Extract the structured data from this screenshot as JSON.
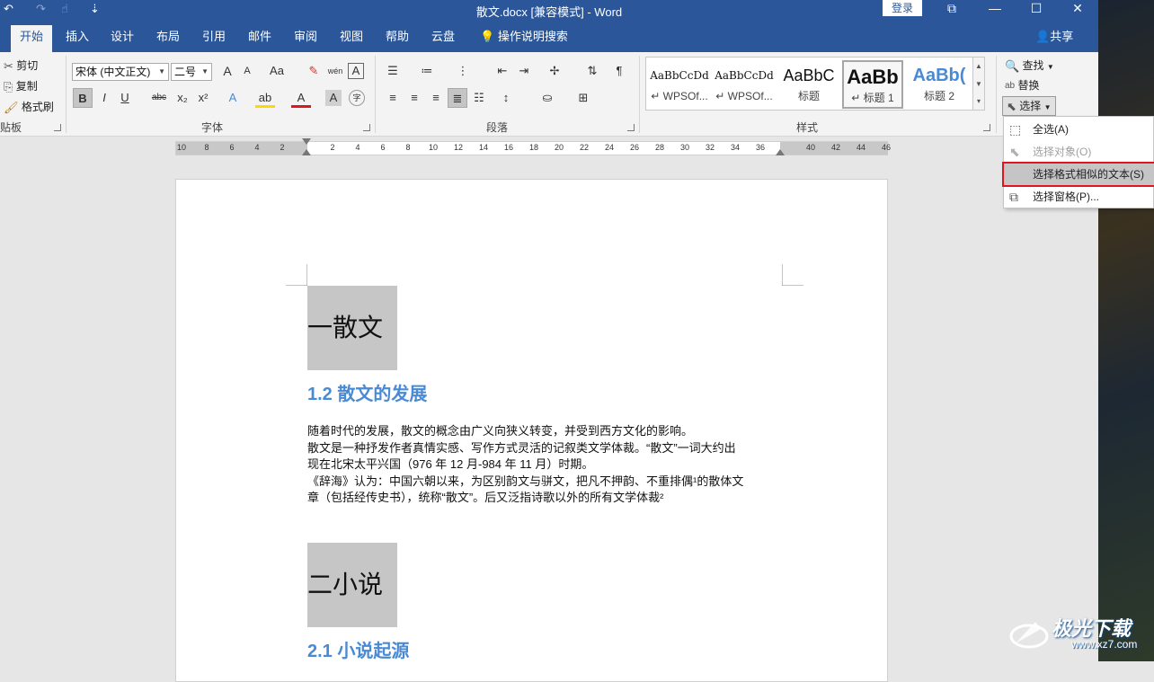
{
  "window": {
    "title": "散文.docx [兼容模式] - Word",
    "login": "登录",
    "qa_undo": "↶",
    "qa_redo": "↷",
    "qa_touch": "☝",
    "qa_customize": "⇣",
    "btn_ribbon_display": "⧉",
    "btn_minimize": "—",
    "btn_maximize": "☐",
    "btn_close": "✕"
  },
  "tabs": [
    {
      "label": "开始",
      "active": true
    },
    {
      "label": "插入"
    },
    {
      "label": "设计"
    },
    {
      "label": "布局"
    },
    {
      "label": "引用"
    },
    {
      "label": "邮件"
    },
    {
      "label": "审阅"
    },
    {
      "label": "视图"
    },
    {
      "label": "帮助"
    },
    {
      "label": "云盘"
    }
  ],
  "tell_me": "说明搜索",
  "tell_me_full": "操作说明搜索",
  "share": "共享",
  "clipboard": {
    "cut": "剪切",
    "copy": "复制",
    "format_painter": "格式刷",
    "label": "贴板"
  },
  "font": {
    "name": "宋体 (中文正文)",
    "size": "二号",
    "label": "字体",
    "bold": "B",
    "italic": "I",
    "underline": "U",
    "strike": "abc",
    "sub": "x₂",
    "sup": "x²",
    "grow": "A",
    "shrink": "A",
    "case": "Aa",
    "clear": "✎",
    "phonetic": "wén",
    "border": "A",
    "effect": "A",
    "highlight": "ab",
    "color": "A",
    "shade": "A",
    "enclose": "字"
  },
  "paragraph": {
    "label": "段落"
  },
  "styles": {
    "label": "样式",
    "items": [
      {
        "sample": "AaBbCcDd",
        "name": "↵ WPSOf..."
      },
      {
        "sample": "AaBbCcDd",
        "name": "↵ WPSOf..."
      },
      {
        "sample": "AaBbC",
        "name": "标题"
      },
      {
        "sample": "AaBb",
        "name": "↵ 标题 1",
        "selected": true
      },
      {
        "sample": "AaBb(",
        "name": "标题 2"
      }
    ]
  },
  "editing": {
    "find": "查找",
    "replace": "替换",
    "select": "选择"
  },
  "select_menu": [
    {
      "label": "全选(A)",
      "icon": "select-all-icon",
      "state": "normal"
    },
    {
      "label": "选择对象(O)",
      "icon": "select-objects-icon",
      "state": "disabled"
    },
    {
      "label": "选择格式相似的文本(S)",
      "icon": "",
      "state": "highlighted"
    },
    {
      "label": "选择窗格(P)...",
      "icon": "selection-pane-icon",
      "state": "normal"
    }
  ],
  "ruler_ticks": [
    "10",
    "8",
    "6",
    "4",
    "2",
    "",
    "2",
    "4",
    "6",
    "8",
    "10",
    "12",
    "14",
    "16",
    "18",
    "20",
    "22",
    "24",
    "26",
    "28",
    "30",
    "32",
    "34",
    "36",
    "",
    "40",
    "42",
    "44",
    "46"
  ],
  "document": {
    "h1_a": "一散文",
    "h2_a": "1.2 散文的发展",
    "para_lines": [
      "随着时代的发展，散文的概念由广义向狭义转变，并受到西方文化的影响。",
      "散文是一种抒发作者真情实感、写作方式灵活的记叙类文学体裁。“散文”一词大约出",
      "现在北宋太平兴国（976 年 12 月-984 年 11 月）时期。",
      "《辞海》认为：中国六朝以来，为区别韵文与骈文，把凡不押韵、不重排偶¹的散体文",
      "章（包括经传史书），统称“散文”。后又泛指诗歌以外的所有文学体裁²"
    ],
    "h1_b": "二小说",
    "h2_b": "2.1 小说起源"
  },
  "watermark": {
    "text": "极光下载",
    "url": "www.xz7.com"
  },
  "colors": {
    "title_bar": "#2b579a",
    "heading2": "#4a8ad4",
    "menu_highlight_border": "#e0161f"
  }
}
